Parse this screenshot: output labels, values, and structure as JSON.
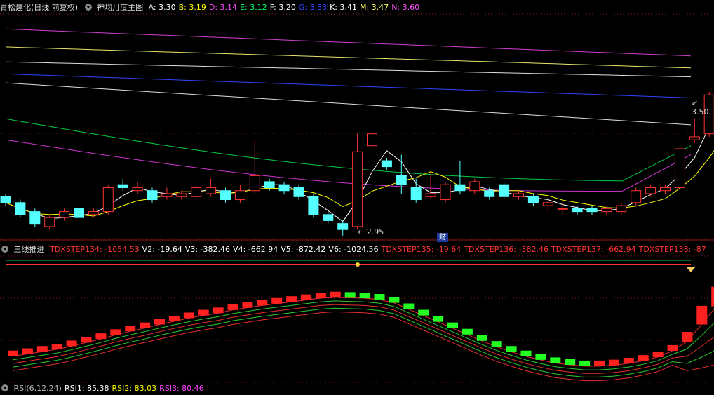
{
  "main_header": {
    "stock": "青松建化(日线 前复权)",
    "indicator": "神均月度主图",
    "items": [
      {
        "label": "A: 3.30",
        "color": "#ffffff"
      },
      {
        "label": "B: 3.19",
        "color": "#ffff00"
      },
      {
        "label": "D: 3.14",
        "color": "#ff44ff"
      },
      {
        "label": "E: 3.12",
        "color": "#00ff66"
      },
      {
        "label": "F: 3.20",
        "color": "#ffffff"
      },
      {
        "label": "G: 3.33",
        "color": "#3344ff"
      },
      {
        "label": "K: 3.41",
        "color": "#ffffff"
      },
      {
        "label": "M: 3.47",
        "color": "#ffff66"
      },
      {
        "label": "N: 3.60",
        "color": "#ff55ff"
      }
    ]
  },
  "sub_header": {
    "indicator": "三线推进",
    "items": [
      {
        "label": "TDXSTEP134: -1054.53",
        "color": "#ff3333"
      },
      {
        "label": "V2: -19.64",
        "color": "#ffffff"
      },
      {
        "label": "V3: -382.46",
        "color": "#ffffff"
      },
      {
        "label": "V4: -662.94",
        "color": "#ffffff"
      },
      {
        "label": "V5: -872.42",
        "color": "#ffffff"
      },
      {
        "label": "V6: -1024.56",
        "color": "#ffffff"
      },
      {
        "label": "TDXSTEP135: -19.64",
        "color": "#ff3333"
      },
      {
        "label": "TDXSTEP136: -382.46",
        "color": "#ff3333"
      },
      {
        "label": "TDXSTEP137: -662.94",
        "color": "#ff3333"
      },
      {
        "label": "TDXSTEP138: -87",
        "color": "#ff3333"
      }
    ]
  },
  "bottom_header": {
    "items": [
      {
        "label": "RSI(6,12,24)",
        "color": "#bbbbbb"
      },
      {
        "label": "RSI1: 85.38",
        "color": "#ffffff"
      },
      {
        "label": "RSI2: 83.03",
        "color": "#ffff00"
      },
      {
        "label": "RSI3: 80.46",
        "color": "#ff44ff"
      }
    ]
  },
  "annotations": {
    "low_label": "2.95",
    "high_label": "3.50",
    "cai_marker": "财"
  },
  "chart_data": {
    "type": "candlestick",
    "candles": [
      {
        "o": 3.04,
        "c": 3.02,
        "h": 3.05,
        "l": 3.01
      },
      {
        "o": 3.02,
        "c": 2.98,
        "h": 3.03,
        "l": 2.97
      },
      {
        "o": 2.99,
        "c": 2.95,
        "h": 3.0,
        "l": 2.94
      },
      {
        "o": 2.94,
        "c": 2.97,
        "h": 2.98,
        "l": 2.93
      },
      {
        "o": 2.97,
        "c": 2.99,
        "h": 3.0,
        "l": 2.96
      },
      {
        "o": 3.0,
        "c": 2.97,
        "h": 3.01,
        "l": 2.96
      },
      {
        "o": 2.98,
        "c": 2.99,
        "h": 3.0,
        "l": 2.97
      },
      {
        "o": 2.99,
        "c": 3.07,
        "h": 3.08,
        "l": 2.98
      },
      {
        "o": 3.08,
        "c": 3.07,
        "h": 3.1,
        "l": 3.06
      },
      {
        "o": 3.06,
        "c": 3.07,
        "h": 3.09,
        "l": 3.05
      },
      {
        "o": 3.06,
        "c": 3.03,
        "h": 3.07,
        "l": 3.02
      },
      {
        "o": 3.04,
        "c": 3.05,
        "h": 3.07,
        "l": 3.03
      },
      {
        "o": 3.04,
        "c": 3.05,
        "h": 3.06,
        "l": 3.03
      },
      {
        "o": 3.04,
        "c": 3.07,
        "h": 3.08,
        "l": 3.03
      },
      {
        "o": 3.05,
        "c": 3.07,
        "h": 3.1,
        "l": 3.04
      },
      {
        "o": 3.06,
        "c": 3.03,
        "h": 3.07,
        "l": 3.02
      },
      {
        "o": 3.03,
        "c": 3.06,
        "h": 3.08,
        "l": 3.02
      },
      {
        "o": 3.06,
        "c": 3.11,
        "h": 3.23,
        "l": 3.05
      },
      {
        "o": 3.09,
        "c": 3.07,
        "h": 3.1,
        "l": 3.06
      },
      {
        "o": 3.08,
        "c": 3.06,
        "h": 3.09,
        "l": 3.05
      },
      {
        "o": 3.07,
        "c": 3.04,
        "h": 3.08,
        "l": 3.03
      },
      {
        "o": 3.04,
        "c": 2.98,
        "h": 3.05,
        "l": 2.97
      },
      {
        "o": 2.98,
        "c": 2.96,
        "h": 2.99,
        "l": 2.95
      },
      {
        "o": 2.95,
        "c": 2.93,
        "h": 2.96,
        "l": 2.91
      },
      {
        "o": 2.94,
        "c": 3.19,
        "h": 3.25,
        "l": 2.93
      },
      {
        "o": 3.21,
        "c": 3.25,
        "h": 3.26,
        "l": 3.2
      },
      {
        "o": 3.16,
        "c": 3.14,
        "h": 3.17,
        "l": 3.13
      },
      {
        "o": 3.11,
        "c": 3.08,
        "h": 3.18,
        "l": 3.05
      },
      {
        "o": 3.07,
        "c": 3.03,
        "h": 3.1,
        "l": 3.02
      },
      {
        "o": 3.04,
        "c": 3.05,
        "h": 3.12,
        "l": 3.03
      },
      {
        "o": 3.03,
        "c": 3.08,
        "h": 3.09,
        "l": 3.02
      },
      {
        "o": 3.08,
        "c": 3.06,
        "h": 3.16,
        "l": 3.05
      },
      {
        "o": 3.06,
        "c": 3.09,
        "h": 3.1,
        "l": 3.05
      },
      {
        "o": 3.06,
        "c": 3.04,
        "h": 3.07,
        "l": 3.03
      },
      {
        "o": 3.08,
        "c": 3.04,
        "h": 3.09,
        "l": 3.03
      },
      {
        "o": 3.04,
        "c": 3.05,
        "h": 3.06,
        "l": 3.03
      },
      {
        "o": 3.04,
        "c": 3.02,
        "h": 3.05,
        "l": 3.01
      },
      {
        "o": 3.01,
        "c": 3.02,
        "h": 3.04,
        "l": 2.99
      },
      {
        "o": 3.0,
        "c": 3.0,
        "h": 3.02,
        "l": 2.98
      },
      {
        "o": 3.0,
        "c": 2.99,
        "h": 3.01,
        "l": 2.98
      },
      {
        "o": 3.0,
        "c": 2.99,
        "h": 3.01,
        "l": 2.98
      },
      {
        "o": 2.99,
        "c": 3.0,
        "h": 3.01,
        "l": 2.98
      },
      {
        "o": 2.99,
        "c": 3.01,
        "h": 3.02,
        "l": 2.98
      },
      {
        "o": 3.02,
        "c": 3.06,
        "h": 3.07,
        "l": 3.01
      },
      {
        "o": 3.05,
        "c": 3.07,
        "h": 3.08,
        "l": 3.04
      },
      {
        "o": 3.06,
        "c": 3.07,
        "h": 3.08,
        "l": 3.05
      },
      {
        "o": 3.07,
        "c": 3.2,
        "h": 3.21,
        "l": 3.06
      },
      {
        "o": 3.23,
        "c": 3.24,
        "h": 3.3,
        "l": 3.22
      },
      {
        "o": 3.25,
        "c": 3.38,
        "h": 3.39,
        "l": 3.24
      },
      {
        "o": 3.4,
        "c": 3.48,
        "h": 3.5,
        "l": 3.37
      }
    ],
    "ylim": [
      2.9,
      3.65
    ],
    "up_color": "#ff3232",
    "down_color": "#54ffff",
    "ma_lines": [
      {
        "name": "N",
        "color": "#d040d0",
        "start": 3.6,
        "end": 3.51
      },
      {
        "name": "M",
        "color": "#e6e66a",
        "start": 3.54,
        "end": 3.47
      },
      {
        "name": "K",
        "color": "#dddddd",
        "start": 3.49,
        "end": 3.44
      },
      {
        "name": "G",
        "color": "#3344ff",
        "start": 3.45,
        "end": 3.37
      },
      {
        "name": "F",
        "color": "#dddddd",
        "start": 3.42,
        "end": 3.28
      },
      {
        "name": "E",
        "color": "#00cc44",
        "start": 3.3,
        "end": 3.09
      },
      {
        "name": "D",
        "color": "#cc33cc",
        "start": 3.23,
        "end": 3.06
      }
    ],
    "sub_panel": {
      "type": "bar",
      "values": [
        -950,
        -945,
        -940,
        -935,
        -928,
        -920,
        -912,
        -903,
        -895,
        -888,
        -880,
        -873,
        -866,
        -860,
        -855,
        -848,
        -843,
        -838,
        -834,
        -830,
        -826,
        -822,
        -820,
        -821,
        -822,
        -825,
        -832,
        -846,
        -860,
        -874,
        -888,
        -902,
        -916,
        -929,
        -940,
        -950,
        -958,
        -965,
        -969,
        -972,
        -972,
        -970,
        -966,
        -960,
        -952,
        -938,
        -918,
        -880,
        -840,
        -795
      ],
      "ylim": [
        -1000,
        -760
      ]
    }
  }
}
